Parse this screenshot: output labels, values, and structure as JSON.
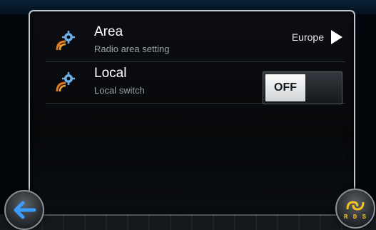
{
  "settings": [
    {
      "title": "Area",
      "subtitle": "Radio area setting",
      "value": "Europe",
      "icon": "gear-signal-icon"
    },
    {
      "title": "Local",
      "subtitle": "Local switch",
      "toggle_state": "OFF",
      "icon": "gear-signal-icon"
    }
  ],
  "nav": {
    "back_icon": "back-arrow-icon",
    "rds_label": "R D S",
    "rds_icon": "rds-icon"
  },
  "colors": {
    "accent_blue": "#2f8cff",
    "rds_gold": "#f4c21a",
    "signal_orange": "#e07a1d"
  }
}
